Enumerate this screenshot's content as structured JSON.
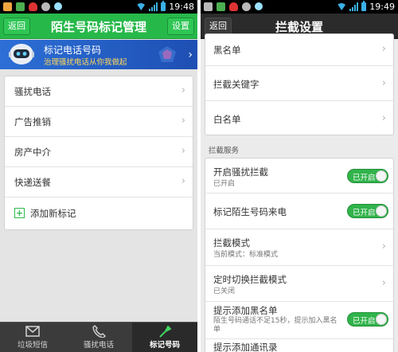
{
  "left": {
    "status": {
      "time": "19:48"
    },
    "header": {
      "back": "返回",
      "title": "陌生号码标记管理",
      "settings": "设置"
    },
    "banner": {
      "title": "标记电话号码",
      "subtitle": "治理骚扰电话从你我做起"
    },
    "items": [
      {
        "label": "骚扰电话"
      },
      {
        "label": "广告推销"
      },
      {
        "label": "房产中介"
      },
      {
        "label": "快递送餐"
      }
    ],
    "add_label": "添加新标记",
    "nav": [
      {
        "label": "垃圾短信",
        "icon": "mail-icon"
      },
      {
        "label": "骚扰电话",
        "icon": "phone-icon"
      },
      {
        "label": "标记号码",
        "icon": "tag-icon"
      }
    ]
  },
  "right": {
    "status": {
      "time": "19:49"
    },
    "header": {
      "back": "返回",
      "title": "拦截设置"
    },
    "top_items": [
      {
        "label": "黑名单"
      },
      {
        "label": "拦截关键字"
      },
      {
        "label": "白名单"
      }
    ],
    "section_title": "拦截服务",
    "service_items": [
      {
        "label": "开启骚扰拦截",
        "sub": "已开启",
        "toggle": "已开启"
      },
      {
        "label": "标记陌生号码来电",
        "toggle": "已开启"
      },
      {
        "label": "拦截模式",
        "sub": "当前模式：标准模式"
      },
      {
        "label": "定时切换拦截模式",
        "sub": "已关闭"
      },
      {
        "label": "提示添加黑名单",
        "sub": "陌生号码通话不足15秒，提示加入黑名单",
        "toggle": "已开启"
      },
      {
        "label": "提示添加通讯录"
      }
    ]
  },
  "colors": {
    "green": "#27b84a",
    "dark_header": "#2b2b2b",
    "toggle_on": "#31b34b"
  }
}
